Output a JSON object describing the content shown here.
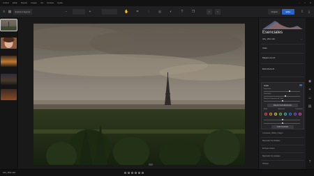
{
  "menu": [
    "Archivo",
    "Editar",
    "Mejorar",
    "Imagen",
    "Ver",
    "Ventana",
    "Ayuda"
  ],
  "toolbar": {
    "left_button": "Explorar imágenes",
    "view_toggle_a": "Original",
    "view_toggle_b": "Editar"
  },
  "status": {
    "filename": "IMG_1554.CR2"
  },
  "panel": {
    "title": "Esenciales",
    "preset": "IMG_1554.CR2",
    "sections": [
      "Cielo",
      "Mejora con AI",
      "Estructura AI"
    ],
    "color_title": "Color",
    "sliders": [
      "Saturación",
      "Intensidad",
      "Eliminar Dominante de Color"
    ],
    "color_button": "Mejorar Automáticamente",
    "tabs": [
      "Matiz",
      "Saturación",
      "Luminancia"
    ],
    "swatch_colors": [
      "#e05050",
      "#e09040",
      "#e0d040",
      "#60c050",
      "#40c0c0",
      "#4070e0",
      "#9050d0",
      "#d050b0"
    ],
    "reset_button": "Color Avanzado",
    "list": [
      "Contraste y Brillo y Negro",
      "Mejorador de Detalles",
      "Enfoque Suave",
      "Mejorador de paisajes",
      "Viñeteo"
    ]
  }
}
